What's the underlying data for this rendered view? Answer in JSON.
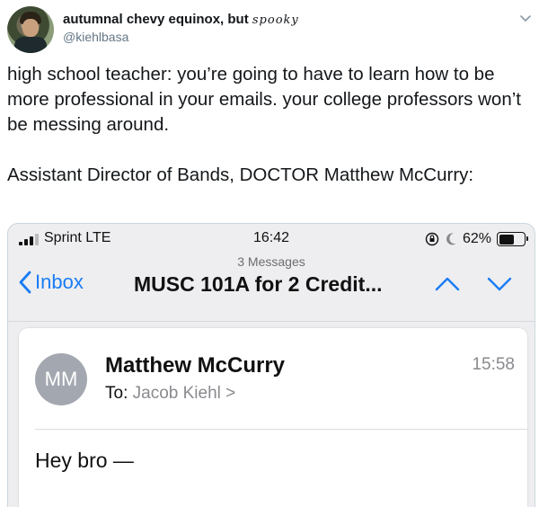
{
  "tweet": {
    "display_name": "autumnal chevy equinox, but",
    "display_name_styled": "spooky",
    "handle": "@kiehlbasa",
    "text": "high school teacher: you’re going to have to learn how to be more professional in your emails. your college professors won’t be messing around.\n\nAssistant Director of Bands, DOCTOR Matthew McCurry:"
  },
  "phone": {
    "carrier": "Sprint LTE",
    "clock": "16:42",
    "battery_percent": "62%",
    "battery_level": 0.62,
    "messages_count": "3 Messages",
    "back_label": "Inbox",
    "subject": "MUSC 101A for 2 Credit..."
  },
  "email": {
    "initials": "MM",
    "sender": "Matthew McCurry",
    "to_label": "To:",
    "recipient": "Jacob Kiehl >",
    "time": "15:58",
    "body": "Hey bro —"
  },
  "colors": {
    "link_blue": "#1a7cf5",
    "avatar_gray": "#a3a7b0"
  },
  "icons": [
    "chevron-down-icon",
    "signal-icon",
    "rotation-lock-icon",
    "moon-icon",
    "battery-icon",
    "back-chevron-icon",
    "up-arrow-icon",
    "down-arrow-icon"
  ]
}
